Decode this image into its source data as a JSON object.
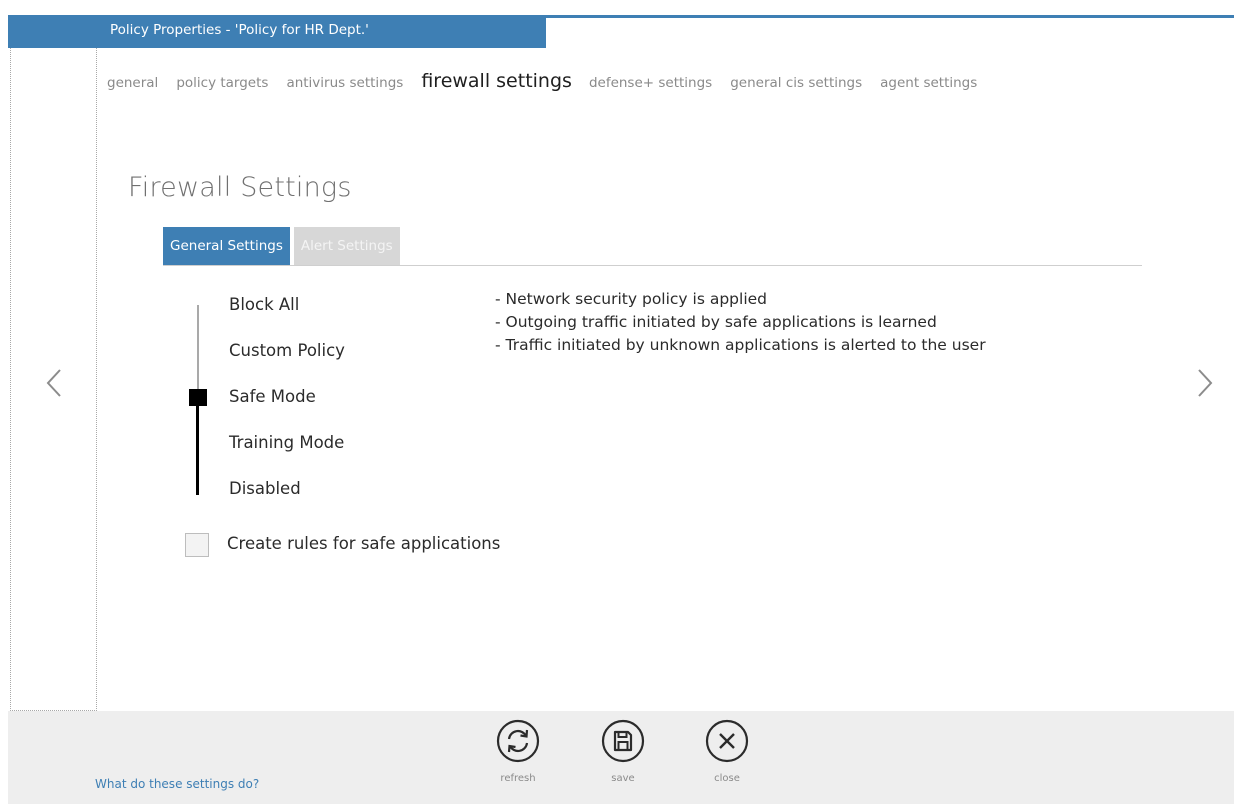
{
  "window": {
    "title": "Policy Properties - 'Policy for HR Dept.'"
  },
  "tabs": [
    {
      "label": "general",
      "active": false
    },
    {
      "label": "policy targets",
      "active": false
    },
    {
      "label": "antivirus settings",
      "active": false
    },
    {
      "label": "firewall settings",
      "active": true
    },
    {
      "label": "defense+ settings",
      "active": false
    },
    {
      "label": "general cis settings",
      "active": false
    },
    {
      "label": "agent settings",
      "active": false
    }
  ],
  "section": {
    "title": "Firewall Settings"
  },
  "subtabs": [
    {
      "label": "General Settings",
      "active": true
    },
    {
      "label": "Alert Settings",
      "active": false
    }
  ],
  "security_levels": {
    "options": [
      "Block All",
      "Custom Policy",
      "Safe Mode",
      "Training Mode",
      "Disabled"
    ],
    "selected": "Safe Mode",
    "selected_index": 2
  },
  "description": [
    "- Network security policy is applied",
    "- Outgoing traffic initiated by safe applications is learned",
    "- Traffic initiated by unknown applications is alerted to the user"
  ],
  "checkbox": {
    "label": "Create rules for safe applications",
    "checked": false
  },
  "nav": {
    "prev_icon": "chevron-left-icon",
    "next_icon": "chevron-right-icon"
  },
  "footer": {
    "help_link": "What do these settings do?",
    "buttons": [
      {
        "label": "refresh",
        "icon": "refresh-icon"
      },
      {
        "label": "save",
        "icon": "save-icon"
      },
      {
        "label": "close",
        "icon": "close-icon"
      }
    ]
  },
  "colors": {
    "accent": "#3e7fb4",
    "inactive_tab": "#d7d7d7",
    "footer_bg": "#eeeeee"
  }
}
